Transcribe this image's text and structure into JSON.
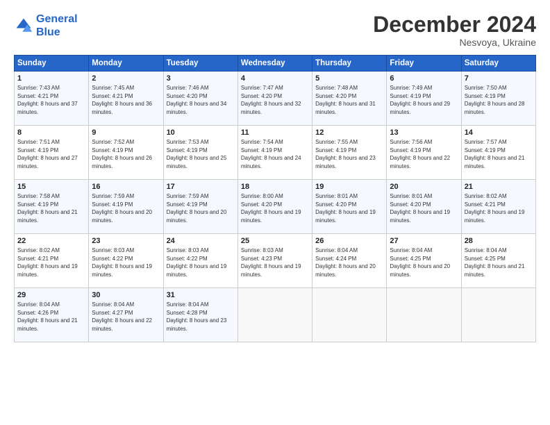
{
  "header": {
    "logo_line1": "General",
    "logo_line2": "Blue",
    "month": "December 2024",
    "location": "Nesvoya, Ukraine"
  },
  "days_of_week": [
    "Sunday",
    "Monday",
    "Tuesday",
    "Wednesday",
    "Thursday",
    "Friday",
    "Saturday"
  ],
  "weeks": [
    [
      {
        "day": "1",
        "sunrise": "Sunrise: 7:43 AM",
        "sunset": "Sunset: 4:21 PM",
        "daylight": "Daylight: 8 hours and 37 minutes."
      },
      {
        "day": "2",
        "sunrise": "Sunrise: 7:45 AM",
        "sunset": "Sunset: 4:21 PM",
        "daylight": "Daylight: 8 hours and 36 minutes."
      },
      {
        "day": "3",
        "sunrise": "Sunrise: 7:46 AM",
        "sunset": "Sunset: 4:20 PM",
        "daylight": "Daylight: 8 hours and 34 minutes."
      },
      {
        "day": "4",
        "sunrise": "Sunrise: 7:47 AM",
        "sunset": "Sunset: 4:20 PM",
        "daylight": "Daylight: 8 hours and 32 minutes."
      },
      {
        "day": "5",
        "sunrise": "Sunrise: 7:48 AM",
        "sunset": "Sunset: 4:20 PM",
        "daylight": "Daylight: 8 hours and 31 minutes."
      },
      {
        "day": "6",
        "sunrise": "Sunrise: 7:49 AM",
        "sunset": "Sunset: 4:19 PM",
        "daylight": "Daylight: 8 hours and 29 minutes."
      },
      {
        "day": "7",
        "sunrise": "Sunrise: 7:50 AM",
        "sunset": "Sunset: 4:19 PM",
        "daylight": "Daylight: 8 hours and 28 minutes."
      }
    ],
    [
      {
        "day": "8",
        "sunrise": "Sunrise: 7:51 AM",
        "sunset": "Sunset: 4:19 PM",
        "daylight": "Daylight: 8 hours and 27 minutes."
      },
      {
        "day": "9",
        "sunrise": "Sunrise: 7:52 AM",
        "sunset": "Sunset: 4:19 PM",
        "daylight": "Daylight: 8 hours and 26 minutes."
      },
      {
        "day": "10",
        "sunrise": "Sunrise: 7:53 AM",
        "sunset": "Sunset: 4:19 PM",
        "daylight": "Daylight: 8 hours and 25 minutes."
      },
      {
        "day": "11",
        "sunrise": "Sunrise: 7:54 AM",
        "sunset": "Sunset: 4:19 PM",
        "daylight": "Daylight: 8 hours and 24 minutes."
      },
      {
        "day": "12",
        "sunrise": "Sunrise: 7:55 AM",
        "sunset": "Sunset: 4:19 PM",
        "daylight": "Daylight: 8 hours and 23 minutes."
      },
      {
        "day": "13",
        "sunrise": "Sunrise: 7:56 AM",
        "sunset": "Sunset: 4:19 PM",
        "daylight": "Daylight: 8 hours and 22 minutes."
      },
      {
        "day": "14",
        "sunrise": "Sunrise: 7:57 AM",
        "sunset": "Sunset: 4:19 PM",
        "daylight": "Daylight: 8 hours and 21 minutes."
      }
    ],
    [
      {
        "day": "15",
        "sunrise": "Sunrise: 7:58 AM",
        "sunset": "Sunset: 4:19 PM",
        "daylight": "Daylight: 8 hours and 21 minutes."
      },
      {
        "day": "16",
        "sunrise": "Sunrise: 7:59 AM",
        "sunset": "Sunset: 4:19 PM",
        "daylight": "Daylight: 8 hours and 20 minutes."
      },
      {
        "day": "17",
        "sunrise": "Sunrise: 7:59 AM",
        "sunset": "Sunset: 4:19 PM",
        "daylight": "Daylight: 8 hours and 20 minutes."
      },
      {
        "day": "18",
        "sunrise": "Sunrise: 8:00 AM",
        "sunset": "Sunset: 4:20 PM",
        "daylight": "Daylight: 8 hours and 19 minutes."
      },
      {
        "day": "19",
        "sunrise": "Sunrise: 8:01 AM",
        "sunset": "Sunset: 4:20 PM",
        "daylight": "Daylight: 8 hours and 19 minutes."
      },
      {
        "day": "20",
        "sunrise": "Sunrise: 8:01 AM",
        "sunset": "Sunset: 4:20 PM",
        "daylight": "Daylight: 8 hours and 19 minutes."
      },
      {
        "day": "21",
        "sunrise": "Sunrise: 8:02 AM",
        "sunset": "Sunset: 4:21 PM",
        "daylight": "Daylight: 8 hours and 19 minutes."
      }
    ],
    [
      {
        "day": "22",
        "sunrise": "Sunrise: 8:02 AM",
        "sunset": "Sunset: 4:21 PM",
        "daylight": "Daylight: 8 hours and 19 minutes."
      },
      {
        "day": "23",
        "sunrise": "Sunrise: 8:03 AM",
        "sunset": "Sunset: 4:22 PM",
        "daylight": "Daylight: 8 hours and 19 minutes."
      },
      {
        "day": "24",
        "sunrise": "Sunrise: 8:03 AM",
        "sunset": "Sunset: 4:22 PM",
        "daylight": "Daylight: 8 hours and 19 minutes."
      },
      {
        "day": "25",
        "sunrise": "Sunrise: 8:03 AM",
        "sunset": "Sunset: 4:23 PM",
        "daylight": "Daylight: 8 hours and 19 minutes."
      },
      {
        "day": "26",
        "sunrise": "Sunrise: 8:04 AM",
        "sunset": "Sunset: 4:24 PM",
        "daylight": "Daylight: 8 hours and 20 minutes."
      },
      {
        "day": "27",
        "sunrise": "Sunrise: 8:04 AM",
        "sunset": "Sunset: 4:25 PM",
        "daylight": "Daylight: 8 hours and 20 minutes."
      },
      {
        "day": "28",
        "sunrise": "Sunrise: 8:04 AM",
        "sunset": "Sunset: 4:25 PM",
        "daylight": "Daylight: 8 hours and 21 minutes."
      }
    ],
    [
      {
        "day": "29",
        "sunrise": "Sunrise: 8:04 AM",
        "sunset": "Sunset: 4:26 PM",
        "daylight": "Daylight: 8 hours and 21 minutes."
      },
      {
        "day": "30",
        "sunrise": "Sunrise: 8:04 AM",
        "sunset": "Sunset: 4:27 PM",
        "daylight": "Daylight: 8 hours and 22 minutes."
      },
      {
        "day": "31",
        "sunrise": "Sunrise: 8:04 AM",
        "sunset": "Sunset: 4:28 PM",
        "daylight": "Daylight: 8 hours and 23 minutes."
      },
      null,
      null,
      null,
      null
    ]
  ]
}
